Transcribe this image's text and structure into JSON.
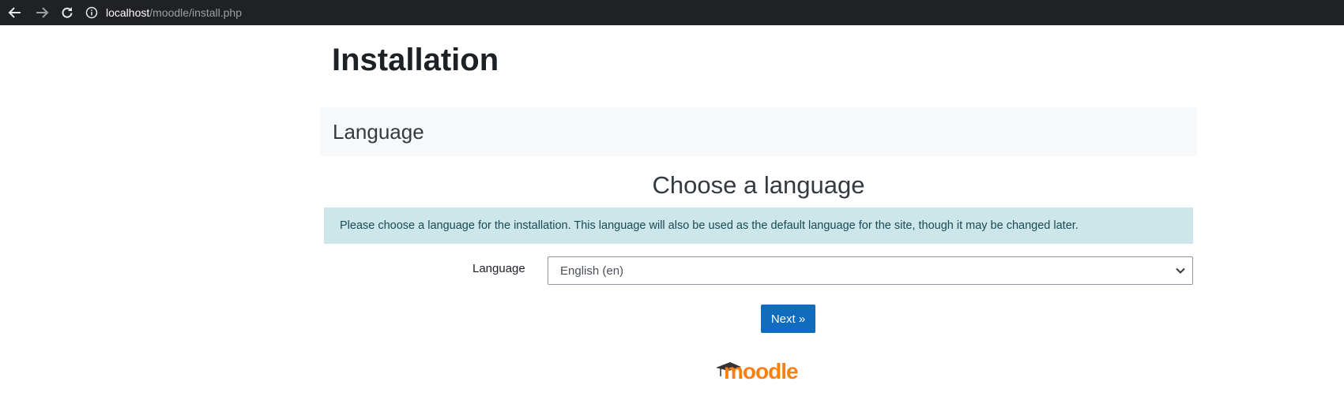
{
  "browser": {
    "url_host": "localhost",
    "url_path": "/moodle/install.php",
    "icons": [
      "back-arrow-icon",
      "forward-arrow-icon",
      "reload-icon",
      "info-icon"
    ]
  },
  "page": {
    "title": "Installation",
    "section_title": "Language",
    "heading": "Choose a language",
    "info_text": "Please choose a language for the installation. This language will also be used as the default language for the site, though it may be changed later.",
    "language_label": "Language",
    "language_value": "English (en)",
    "next_label": "Next »"
  },
  "logo": {
    "text": "moodle",
    "color": "#f98012"
  },
  "colors": {
    "browser_bar": "#202124",
    "primary_button": "#0f6cbf",
    "info_background": "#cce6ea",
    "section_background": "#f7f8f9"
  }
}
